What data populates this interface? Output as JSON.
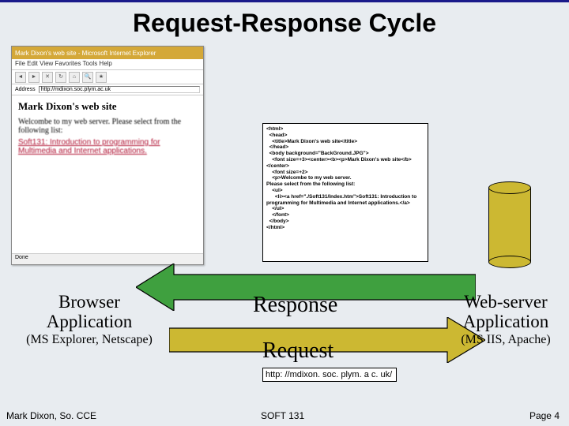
{
  "title": "Request-Response Cycle",
  "browser_window": {
    "titlebar": "Mark Dixon's web site - Microsoft Internet Explorer",
    "menubar": "File   Edit   View   Favorites   Tools   Help",
    "address_label": "Address",
    "address_value": "http://mdixon.soc.plym.ac.uk",
    "content_heading": "Mark Dixon's web site",
    "content_p1": "Welcombe to my web server. Please select from the following list:",
    "content_link": "Soft131: Introduction to programming for Multimedia and Internet applications.",
    "statusbar": "Done"
  },
  "code_box": "<html>\n  <head>\n    <title>Mark Dixon's web site</title>\n  </head>\n  <body background=\"BackGround.JPG\">\n    <font size=+3><center><b><p>Mark Dixon's web site</b></center>\n    <font size=+2>\n    <p>Welcombe to my web server.\nPlease select from the following list:\n    <ul>\n      <li><a href=\"./Soft131/Index.htm\">Soft131: Introduction to programming for Multimedia and Internet applications.</a>\n    </ul>\n    </font>\n  </body>\n</html>",
  "labels": {
    "browser_app": "Browser Application",
    "browser_sub": "(MS Explorer, Netscape)",
    "response": "Response",
    "request": "Request",
    "webserver_app": "Web-server Application",
    "webserver_sub": "(MS IIS, Apache)"
  },
  "url_box": "http: //mdixon. soc. plym. a c. uk/",
  "footer": {
    "left": "Mark Dixon, So. CCE",
    "mid": "SOFT 131",
    "right": "Page 4"
  }
}
